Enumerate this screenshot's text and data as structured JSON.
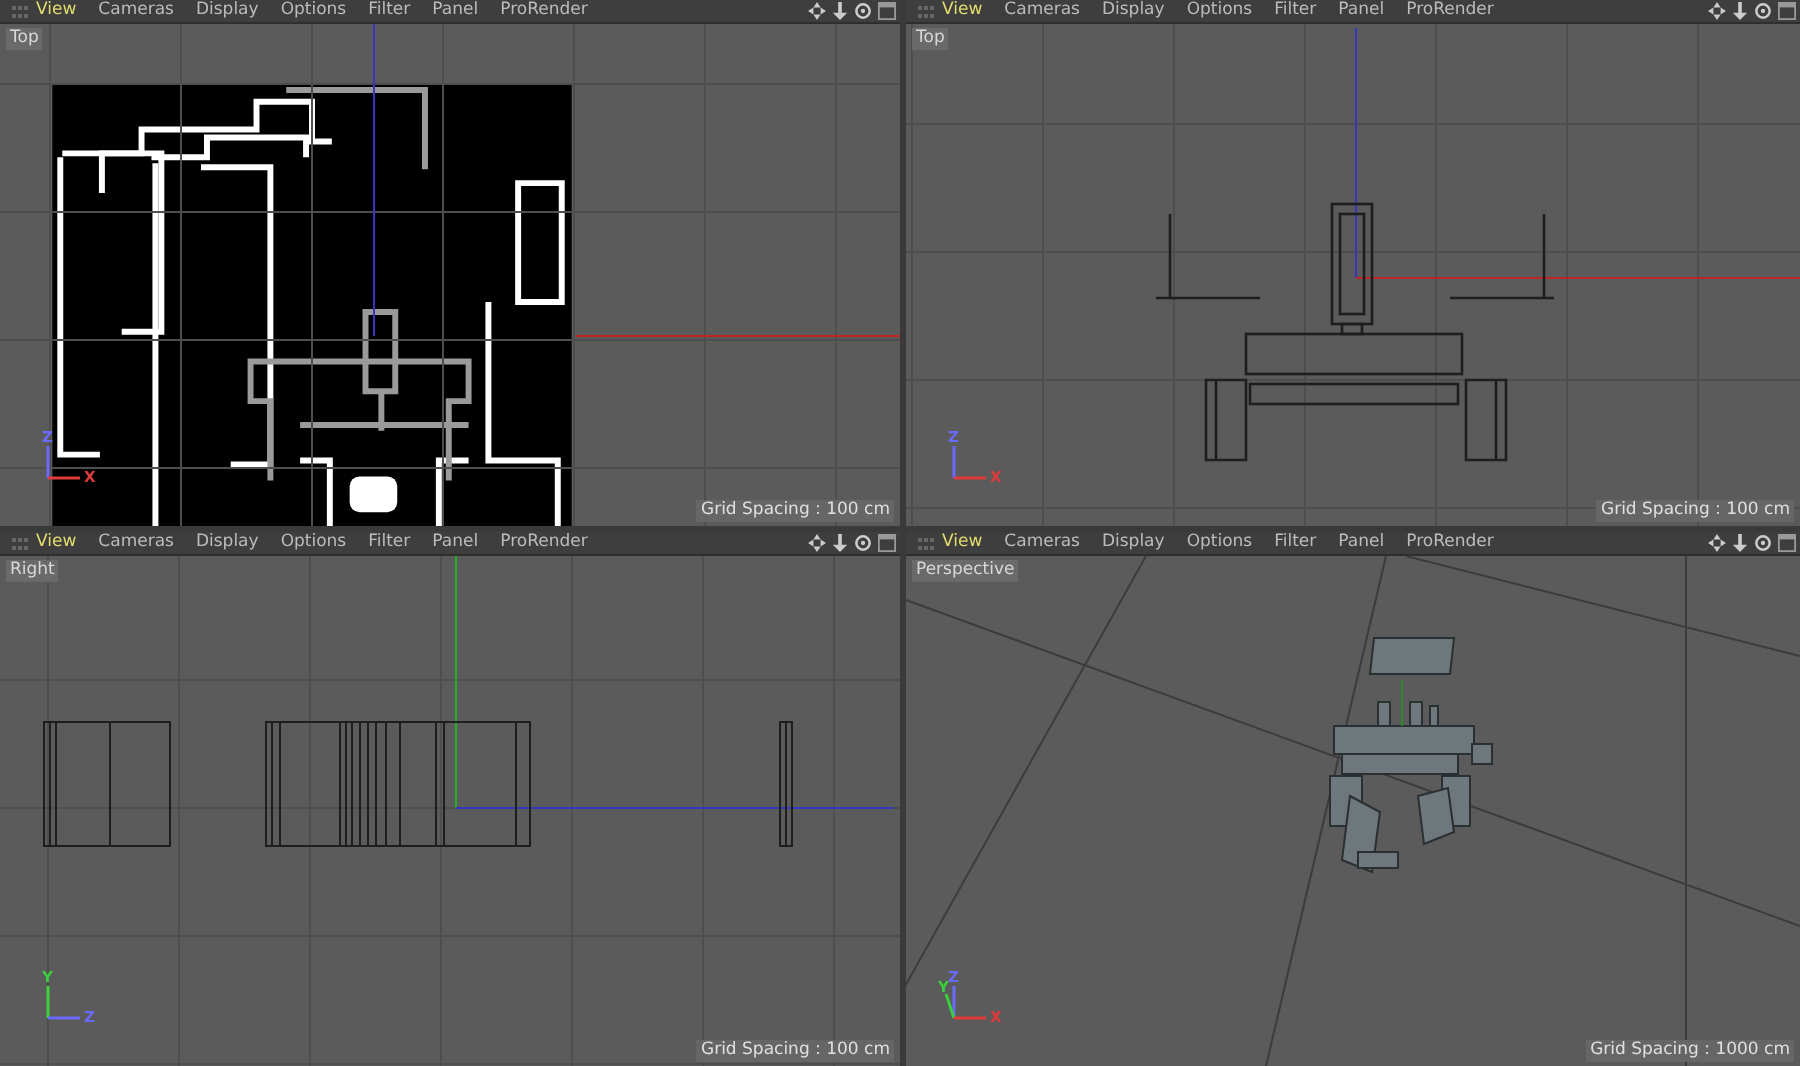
{
  "viewports": [
    {
      "kind": "texture",
      "label": "Top",
      "menu": [
        {
          "label": "View",
          "selected": true
        },
        {
          "label": "Cameras",
          "selected": false
        },
        {
          "label": "Display",
          "selected": false
        },
        {
          "label": "Options",
          "selected": false
        },
        {
          "label": "Filter",
          "selected": false
        },
        {
          "label": "Panel",
          "selected": false
        },
        {
          "label": "ProRender",
          "selected": false
        }
      ],
      "grid_spacing": "Grid Spacing : 100 cm",
      "axes": [
        {
          "label": "Z",
          "color": "#6a6aff"
        },
        {
          "label": "X",
          "color": "#e03a3a"
        }
      ]
    },
    {
      "kind": "top_wire",
      "label": "Top",
      "menu": [
        {
          "label": "View",
          "selected": true
        },
        {
          "label": "Cameras",
          "selected": false
        },
        {
          "label": "Display",
          "selected": false
        },
        {
          "label": "Options",
          "selected": false
        },
        {
          "label": "Filter",
          "selected": false
        },
        {
          "label": "Panel",
          "selected": false
        },
        {
          "label": "ProRender",
          "selected": false
        }
      ],
      "grid_spacing": "Grid Spacing : 100 cm",
      "axes": [
        {
          "label": "Z",
          "color": "#6a6aff"
        },
        {
          "label": "X",
          "color": "#e03a3a"
        }
      ]
    },
    {
      "kind": "side_wire",
      "label": "Right",
      "menu": [
        {
          "label": "View",
          "selected": true
        },
        {
          "label": "Cameras",
          "selected": false
        },
        {
          "label": "Display",
          "selected": false
        },
        {
          "label": "Options",
          "selected": false
        },
        {
          "label": "Filter",
          "selected": false
        },
        {
          "label": "Panel",
          "selected": false
        },
        {
          "label": "ProRender",
          "selected": false
        }
      ],
      "grid_spacing": "Grid Spacing : 100 cm",
      "axes": [
        {
          "label": "Y",
          "color": "#3ccf3c"
        },
        {
          "label": "Z",
          "color": "#6a6aff"
        }
      ]
    },
    {
      "kind": "perspective",
      "label": "Perspective",
      "menu": [
        {
          "label": "View",
          "selected": true
        },
        {
          "label": "Cameras",
          "selected": false
        },
        {
          "label": "Display",
          "selected": false
        },
        {
          "label": "Options",
          "selected": false
        },
        {
          "label": "Filter",
          "selected": false
        },
        {
          "label": "Panel",
          "selected": false
        },
        {
          "label": "ProRender",
          "selected": false
        }
      ],
      "grid_spacing": "Grid Spacing : 1000 cm",
      "axes": [
        {
          "label": "Z",
          "color": "#6a6aff"
        },
        {
          "label": "Y",
          "color": "#3ccf3c"
        },
        {
          "label": "X",
          "color": "#e03a3a"
        }
      ]
    }
  ]
}
